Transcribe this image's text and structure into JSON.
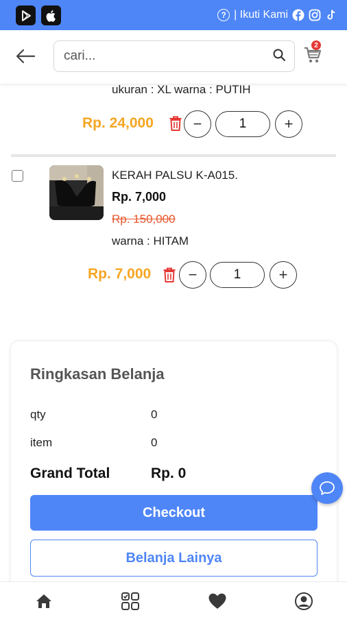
{
  "topbar": {
    "follow_label": "| Ikuti Kami",
    "help_glyph": "?",
    "icons": [
      "play-store-icon",
      "apple-icon",
      "help-icon",
      "facebook-icon",
      "instagram-icon",
      "tiktok-icon"
    ]
  },
  "header": {
    "search_placeholder": "cari...",
    "cart_count": "2"
  },
  "items": [
    {
      "variant": "ukuran : XL warna : PUTIH",
      "row_price": "Rp. 24,000",
      "qty": "1"
    },
    {
      "name": "KERAH PALSU K-A015.",
      "price": "Rp. 7,000",
      "old_price": "Rp. 150,000",
      "variant": "warna : HITAM",
      "row_price": "Rp. 7,000",
      "qty": "1"
    }
  ],
  "qty_controls": {
    "minus": "−",
    "plus": "+"
  },
  "summary": {
    "title": "Ringkasan Belanja",
    "qty_label": "qty",
    "qty_value": "0",
    "item_label": "item",
    "item_value": "0",
    "grand_label": "Grand Total",
    "grand_value": "Rp. 0",
    "checkout_label": "Checkout",
    "continue_label": "Belanja Lainya"
  },
  "colors": {
    "accent": "#4f86f7",
    "price_orange": "#f5a623",
    "strike_red": "#e8562a",
    "trash_red": "#e53935"
  },
  "bottom_nav": [
    "home-icon",
    "categories-icon",
    "wishlist-icon",
    "profile-icon"
  ]
}
